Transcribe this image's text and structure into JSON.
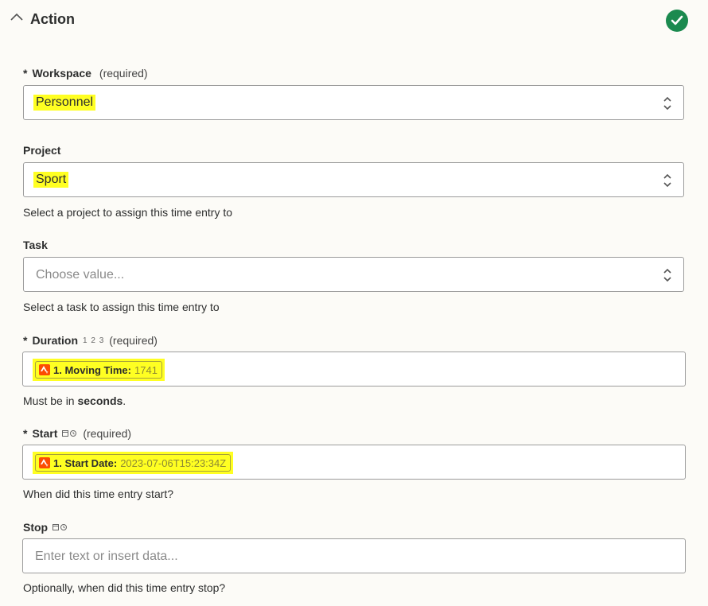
{
  "header": {
    "title": "Action"
  },
  "fields": {
    "workspace": {
      "asterisk": "*",
      "label": "Workspace",
      "required": "(required)",
      "value": "Personnel"
    },
    "project": {
      "label": "Project",
      "value": "Sport",
      "help": "Select a project to assign this time entry to"
    },
    "task": {
      "label": "Task",
      "placeholder": "Choose value...",
      "help": "Select a task to assign this time entry to"
    },
    "duration": {
      "asterisk": "*",
      "label": "Duration",
      "type_hint": "1 2 3",
      "required": "(required)",
      "chip_label": "1. Moving Time:",
      "chip_value": "1741",
      "help_prefix": "Must be in ",
      "help_bold": "seconds",
      "help_suffix": "."
    },
    "start": {
      "asterisk": "*",
      "label": "Start",
      "required": "(required)",
      "chip_label": "1. Start Date:",
      "chip_value": "2023-07-06T15:23:34Z",
      "help": "When did this time entry start?"
    },
    "stop": {
      "label": "Stop",
      "placeholder": "Enter text or insert data...",
      "help": "Optionally, when did this time entry stop?"
    }
  },
  "colors": {
    "highlight": "#ffff22",
    "success": "#1b8a4f",
    "app_icon": "#fc4c02"
  }
}
